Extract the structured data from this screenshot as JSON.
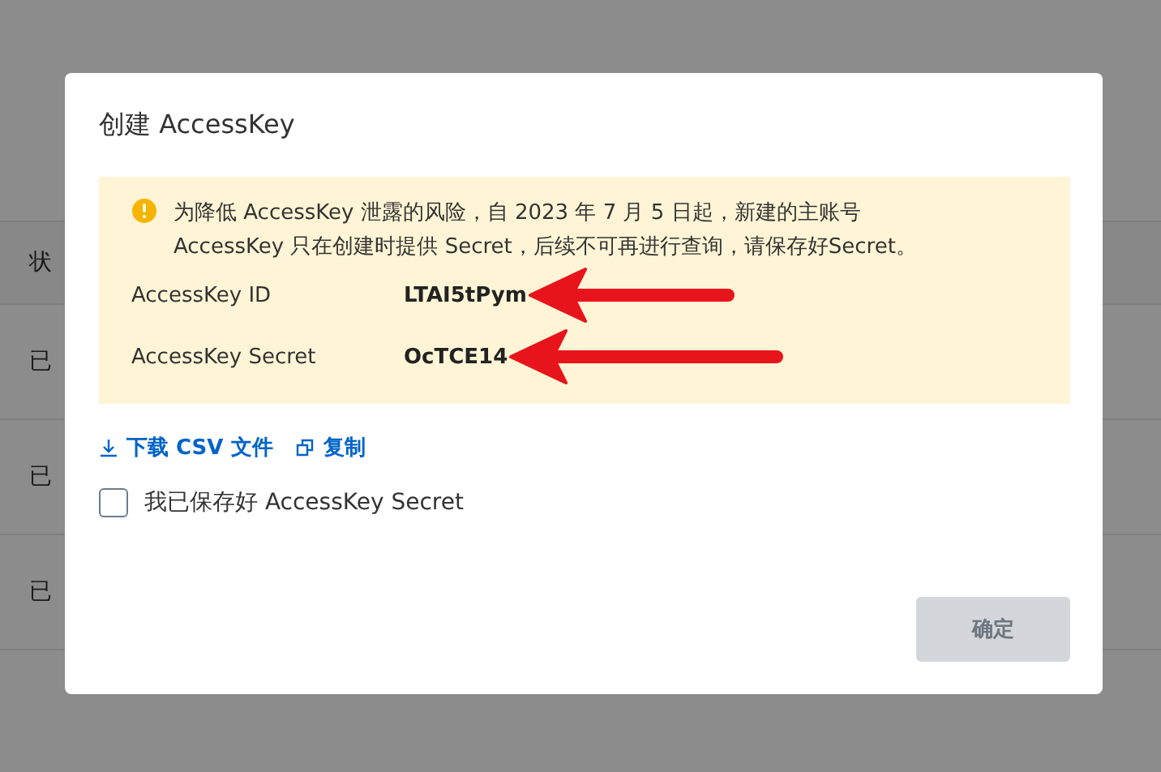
{
  "background_table": {
    "header": "状",
    "rows": [
      "已",
      "已",
      "已"
    ]
  },
  "dialog": {
    "title": "创建 AccessKey",
    "notice": {
      "kind": "warning",
      "text": "为降低 AccessKey 泄露的风险，自 2023 年 7 月 5 日起，新建的主账号 AccessKey 只在创建时提供 Secret，后续不可再进行查询，请保存好Secret。"
    },
    "fields": [
      {
        "label": "AccessKey ID",
        "value": "LTAI5tPym"
      },
      {
        "label": "AccessKey Secret",
        "value": "OcTCE14"
      }
    ],
    "actions": [
      {
        "kind": "download",
        "label": "下载 CSV 文件"
      },
      {
        "kind": "copy",
        "label": "复制"
      }
    ],
    "confirm_checkbox": {
      "label": "我已保存好 AccessKey Secret",
      "checked": false
    },
    "ok_button": {
      "label": "确定",
      "disabled": true
    }
  }
}
